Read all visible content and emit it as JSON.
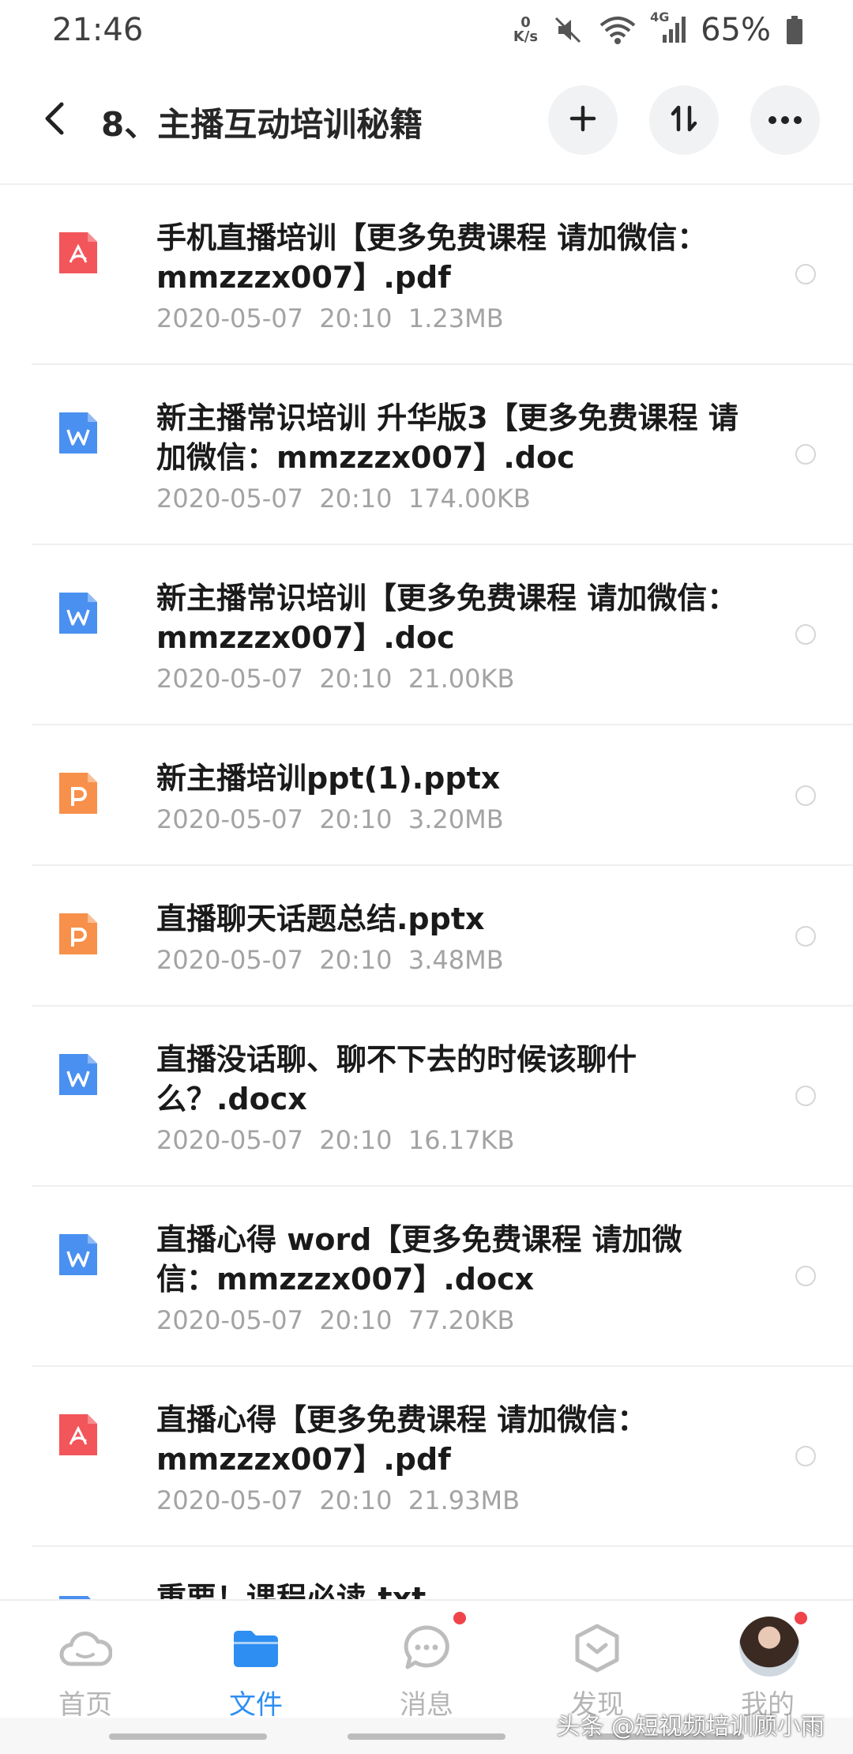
{
  "status_bar": {
    "time": "21:46",
    "net_speed_value": "0",
    "net_speed_unit": "K/s",
    "network_label": "4G",
    "battery": "65%"
  },
  "header": {
    "title": "8、主播互动培训秘籍",
    "icons": [
      "back-arrow-icon",
      "plus-icon",
      "sort-icon",
      "more-icon"
    ]
  },
  "files": [
    {
      "type": "pdf",
      "name": "手机直播培训【更多免费课程 请加微信：mmzzzx007】.pdf",
      "date": "2020-05-07",
      "time": "20:10",
      "size": "1.23MB"
    },
    {
      "type": "word",
      "name": "新主播常识培训 升华版3【更多免费课程 请加微信：mmzzzx007】.doc",
      "date": "2020-05-07",
      "time": "20:10",
      "size": "174.00KB"
    },
    {
      "type": "word",
      "name": "新主播常识培训【更多免费课程 请加微信：mmzzzx007】.doc",
      "date": "2020-05-07",
      "time": "20:10",
      "size": "21.00KB"
    },
    {
      "type": "ppt",
      "name": "新主播培训ppt(1).pptx",
      "date": "2020-05-07",
      "time": "20:10",
      "size": "3.20MB"
    },
    {
      "type": "ppt",
      "name": "直播聊天话题总结.pptx",
      "date": "2020-05-07",
      "time": "20:10",
      "size": "3.48MB"
    },
    {
      "type": "word",
      "name": "直播没话聊、聊不下去的时候该聊什么？.docx",
      "date": "2020-05-07",
      "time": "20:10",
      "size": "16.17KB"
    },
    {
      "type": "word",
      "name": "直播心得 word【更多免费课程 请加微信：mmzzzx007】.docx",
      "date": "2020-05-07",
      "time": "20:10",
      "size": "77.20KB"
    },
    {
      "type": "pdf",
      "name": "直播心得【更多免费课程 请加微信：mmzzzx007】.pdf",
      "date": "2020-05-07",
      "time": "20:10",
      "size": "21.93MB"
    },
    {
      "type": "txt",
      "name": "重要！课程必读.txt",
      "date": "",
      "time": "",
      "size": ""
    }
  ],
  "colors": {
    "pdf": "#f2555a",
    "word": "#4a90f0",
    "ppt": "#f7904a",
    "accent": "#2e8ef2"
  },
  "bottom_nav": {
    "tabs": [
      {
        "label": "首页",
        "icon": "cloud-icon"
      },
      {
        "label": "文件",
        "icon": "folder-icon"
      },
      {
        "label": "消息",
        "icon": "chat-icon"
      },
      {
        "label": "发现",
        "icon": "discover-icon"
      },
      {
        "label": "我的",
        "icon": "avatar"
      }
    ]
  },
  "watermark": "头条 @短视频培训顾小雨"
}
